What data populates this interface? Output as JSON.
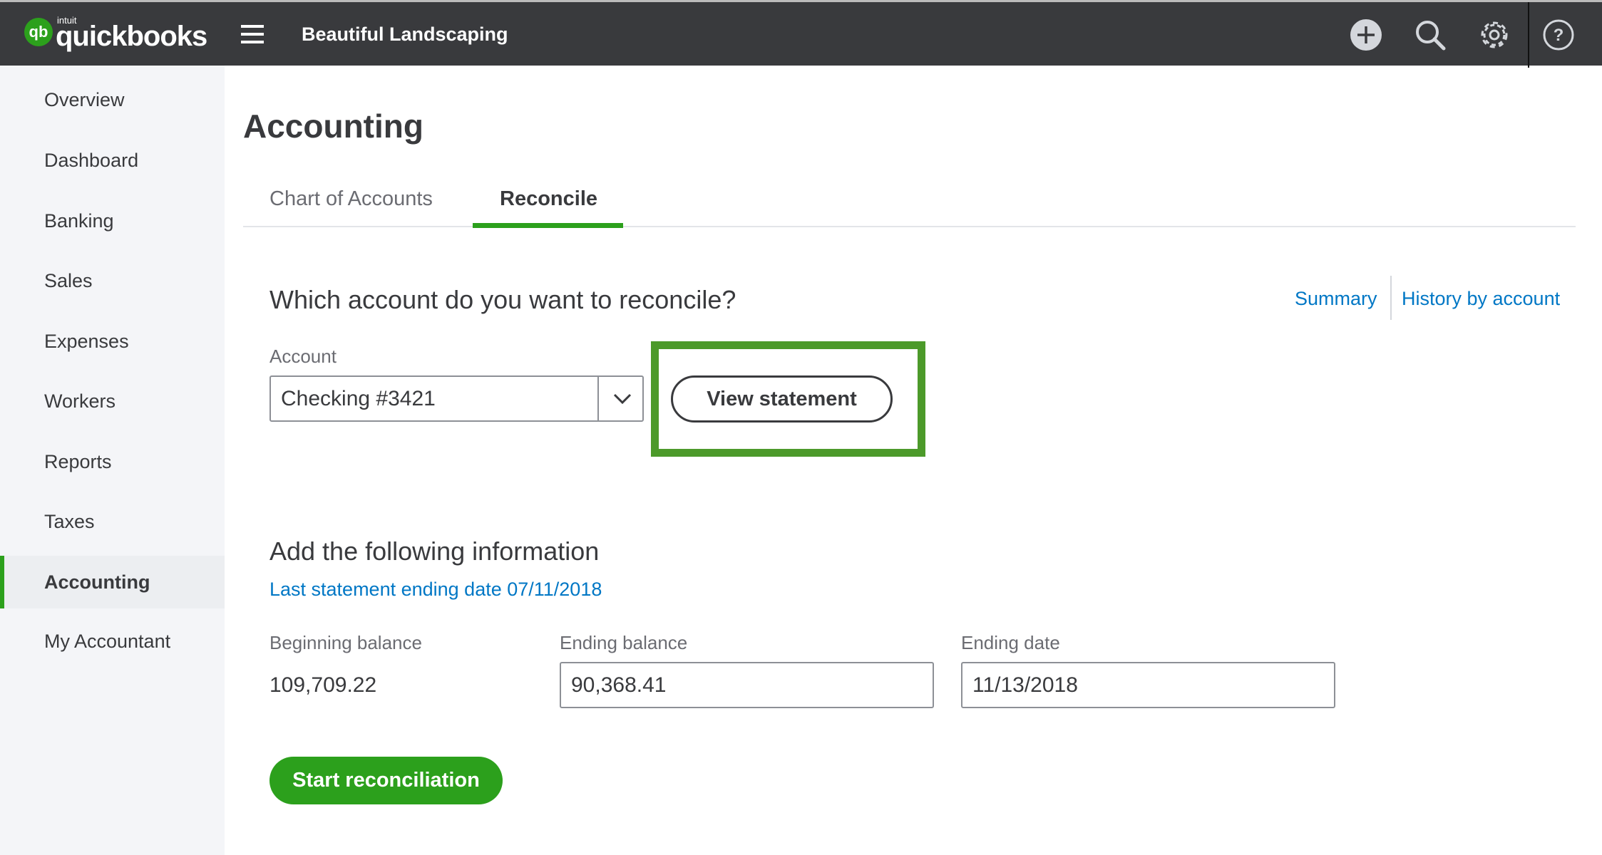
{
  "header": {
    "logo_top": "intuit",
    "logo": "quickbooks",
    "logo_mark": "qb",
    "company": "Beautiful Landscaping"
  },
  "sidebar": {
    "items": [
      "Overview",
      "Dashboard",
      "Banking",
      "Sales",
      "Expenses",
      "Workers",
      "Reports",
      "Taxes",
      "Accounting",
      "My Accountant"
    ],
    "active": "Accounting"
  },
  "page": {
    "title": "Accounting",
    "tabs": [
      "Chart of Accounts",
      "Reconcile"
    ],
    "active_tab": "Reconcile"
  },
  "reconcile": {
    "question": "Which account do you want to reconcile?",
    "summary_link": "Summary",
    "history_link": "History by account",
    "account_label": "Account",
    "account_value": "Checking #3421",
    "view_statement": "View statement",
    "add_info": "Add the following information",
    "last_statement": "Last statement ending date 07/11/2018",
    "beginning_label": "Beginning balance",
    "beginning_value": "109,709.22",
    "ending_balance_label": "Ending balance",
    "ending_balance_value": "90,368.41",
    "ending_date_label": "Ending date",
    "ending_date_value": "11/13/2018",
    "start_button": "Start reconciliation"
  },
  "colors": {
    "brand_green": "#2ca01c",
    "link_blue": "#0077c5",
    "header_bg": "#393a3d",
    "highlight": "#4c9a2a"
  }
}
